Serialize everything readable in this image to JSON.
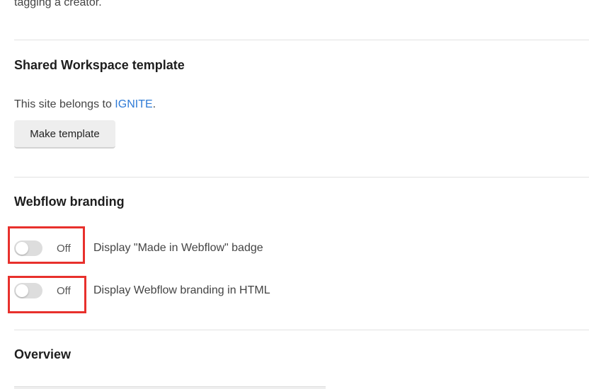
{
  "top_text": "tagging a creator.",
  "shared_workspace": {
    "title": "Shared Workspace template",
    "desc_prefix": "This site belongs to ",
    "desc_link": "IGNITE",
    "desc_suffix": ".",
    "button_label": "Make template"
  },
  "branding": {
    "title": "Webflow branding",
    "toggles": [
      {
        "state": "Off",
        "label": "Display \"Made in Webflow\" badge"
      },
      {
        "state": "Off",
        "label": "Display Webflow branding in HTML"
      }
    ]
  },
  "overview": {
    "title": "Overview"
  },
  "colors": {
    "link": "#2f7bd6",
    "highlight": "#e8302c",
    "toggle_off": "#dddddd"
  }
}
